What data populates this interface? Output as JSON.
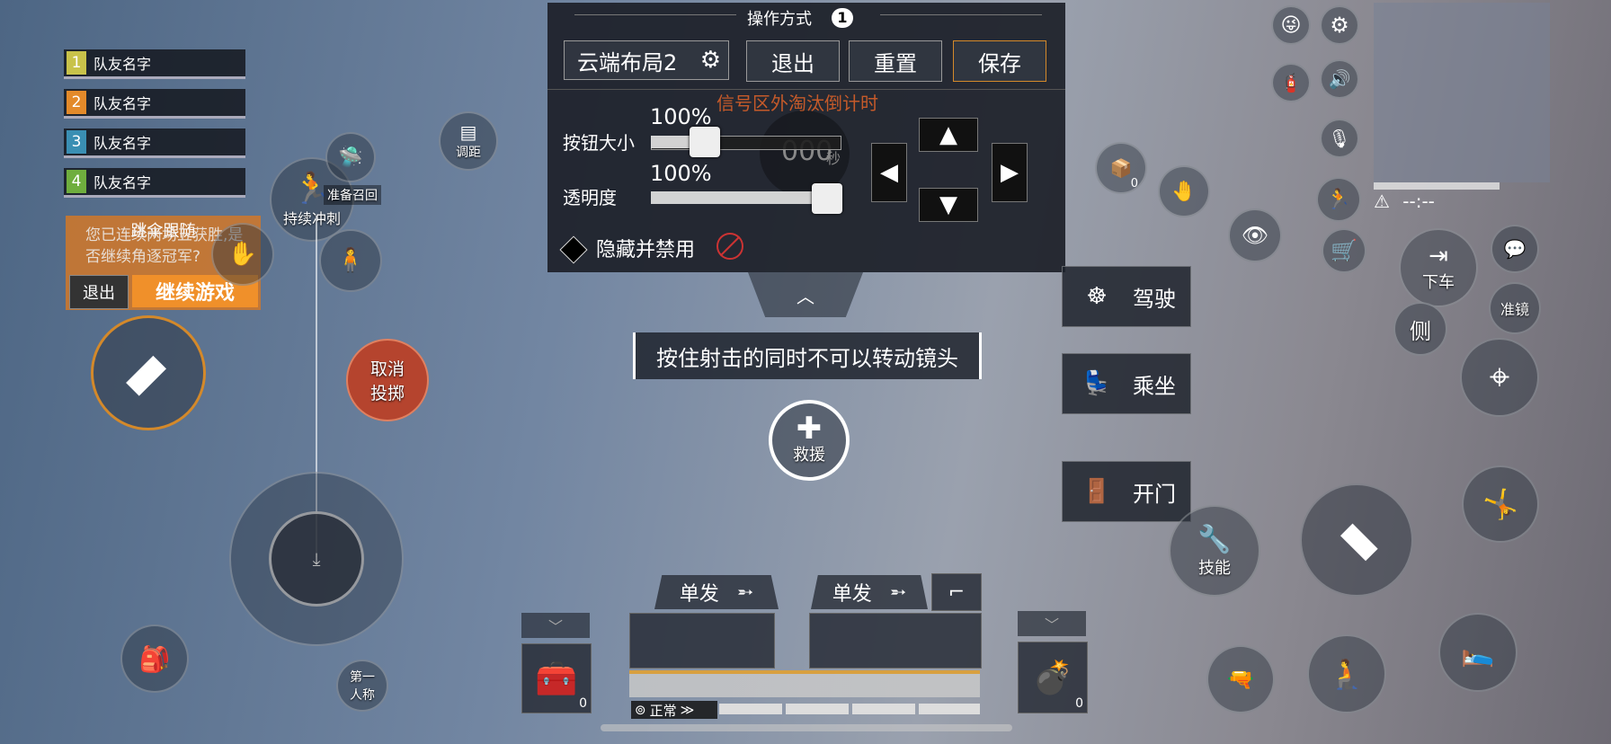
{
  "team": [
    {
      "num": "1",
      "name": "队友名字",
      "color": "#c8c24a"
    },
    {
      "num": "2",
      "name": "队友名字",
      "color": "#e38a2a"
    },
    {
      "num": "3",
      "name": "队友名字",
      "color": "#3a8fb3"
    },
    {
      "num": "4",
      "name": "队友名字",
      "color": "#6fae3e"
    }
  ],
  "popup": {
    "title": "跳伞跟随",
    "question": "您已连续两场五获胜,是否继续角逐冠军?",
    "exit": "退出",
    "continue": "继续游戏"
  },
  "left": {
    "sprint": "持续冲刺",
    "recall": "准备召回",
    "range": "调距",
    "cancel_throw_line1": "取消",
    "cancel_throw_line2": "投掷",
    "view_line1": "第一",
    "view_line2": "人称"
  },
  "panel": {
    "title": "操作方式",
    "badge": "1",
    "layout_name": "云端布局2",
    "exit": "退出",
    "reset": "重置",
    "save": "保存",
    "warning": "信号区外淘汰倒计时",
    "size_label": "按钮大小",
    "size_value": "100%",
    "opacity_label": "透明度",
    "opacity_value": "100%",
    "countdown": "000",
    "countdown_unit": "秒",
    "hide_disable": "隐藏并禁用"
  },
  "hint": "按住射击的同时不可以转动镜头",
  "rescue": "救援",
  "actions": {
    "drive": "驾驶",
    "ride": "乘坐",
    "door": "开门"
  },
  "right": {
    "exit_vehicle": "下车",
    "scope": "准镜",
    "side": "侧",
    "skill": "技能",
    "supply_count": "0",
    "timer": "--:--"
  },
  "weapons": {
    "slot1_mode": "单发",
    "slot2_mode": "单发",
    "status": "正常",
    "med_count": "0",
    "grenade_count": "0"
  },
  "colors": {
    "save_border": "#d4892a",
    "continue_bg": "#f0902a",
    "warning": "#c55a2a",
    "cancel_bg": "#b5442e"
  }
}
